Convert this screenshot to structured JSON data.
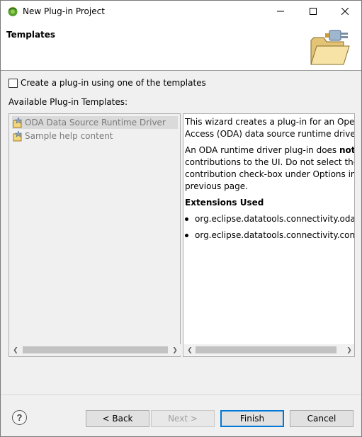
{
  "window": {
    "title": "New Plug-in Project"
  },
  "banner": {
    "title": "Templates"
  },
  "options": {
    "use_template_label": "Create a plug-in using one of the templates",
    "use_template_checked": false,
    "available_label": "Available Plug-in Templates:"
  },
  "templates": [
    {
      "label": "ODA Data Source Runtime Driver",
      "selected": true
    },
    {
      "label": "Sample help content",
      "selected": false
    }
  ],
  "description": {
    "para1_line1": "This wizard creates a plug-in for an Open Da",
    "para1_line2": "Access (ODA) data source runtime driver.",
    "para2_line1_pre": "An ODA runtime driver plug-in does ",
    "para2_line1_bold": "not",
    "para2_line1_post": " ma",
    "para2_line2": "contributions to the UI. Do not select the UI",
    "para2_line3": "contribution check-box under Options in the",
    "para2_line4": "previous page.",
    "extensions_heading": "Extensions Used",
    "extensions": [
      "org.eclipse.datatools.connectivity.oda.data",
      "org.eclipse.datatools.connectivity.connect"
    ]
  },
  "buttons": {
    "back": "< Back",
    "next": "Next >",
    "finish": "Finish",
    "cancel": "Cancel"
  },
  "colors": {
    "accent": "#0078d7",
    "disabled_text": "#a0a0a0",
    "selection": "#dadada"
  }
}
